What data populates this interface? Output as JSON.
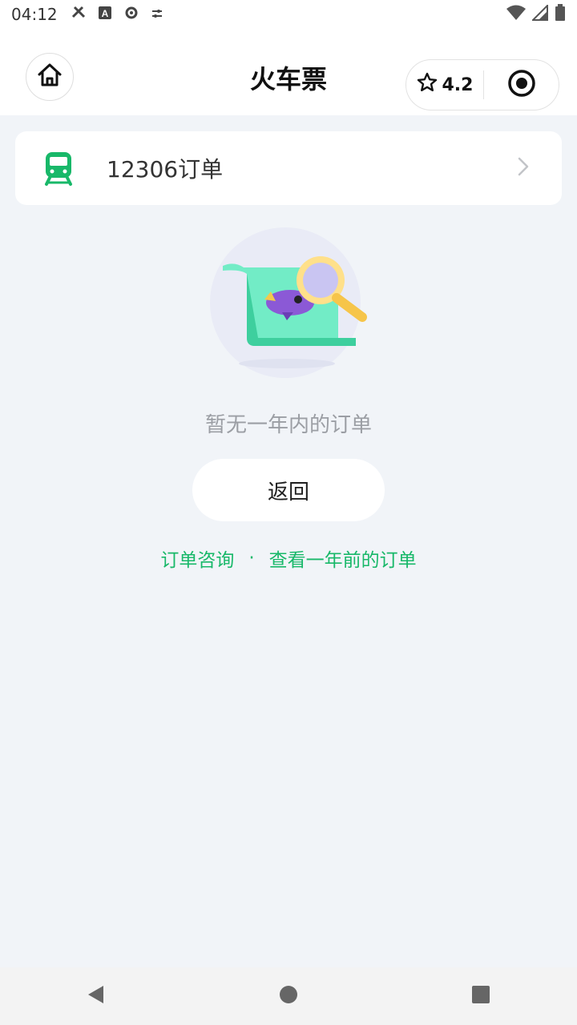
{
  "status_bar": {
    "time": "04:12",
    "icons": [
      "tools-icon",
      "text-a-icon",
      "settings-gear-icon",
      "sliders-icon"
    ],
    "right_icons": [
      "wifi-icon",
      "signal-icon",
      "battery-icon"
    ]
  },
  "header": {
    "title": "火车票",
    "rating": "4.2"
  },
  "order_card": {
    "label": "12306订单"
  },
  "empty_state": {
    "message": "暂无一年内的订单",
    "back_button": "返回"
  },
  "links": {
    "inquiry": "订单咨询",
    "separator": "·",
    "older_orders": "查看一年前的订单"
  },
  "colors": {
    "accent_green": "#18b869",
    "background": "#f1f4f8"
  }
}
